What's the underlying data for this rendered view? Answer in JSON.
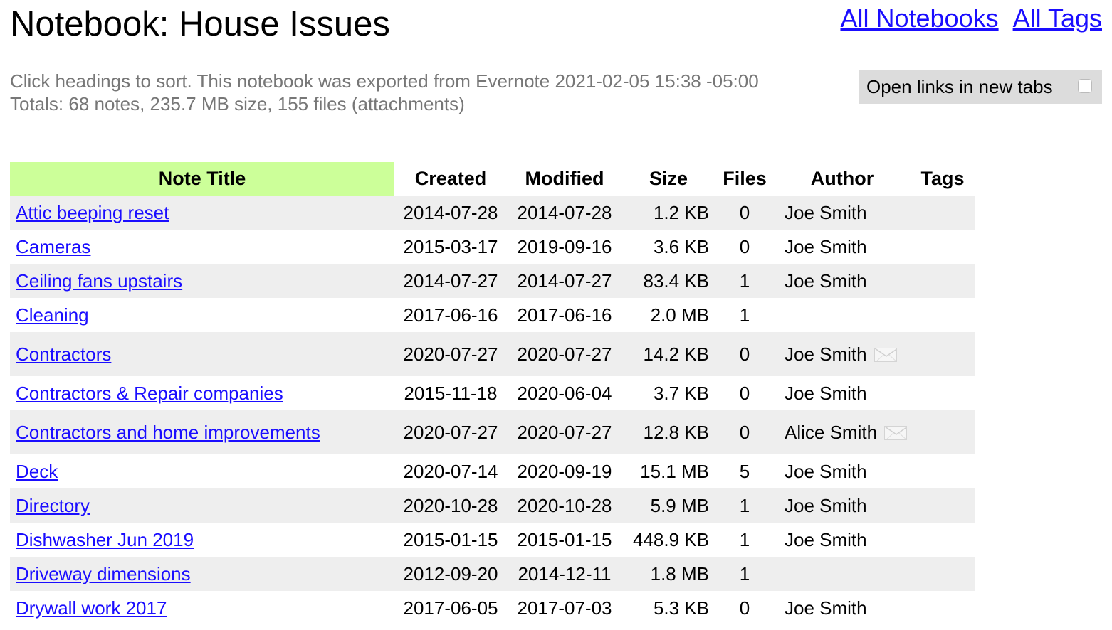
{
  "title": "Notebook: House Issues",
  "links": {
    "all_notebooks": "All Notebooks",
    "all_tags": "All Tags"
  },
  "info": {
    "line1": "Click headings to sort. This notebook was exported from Evernote 2021-02-05 15:38 -05:00",
    "line2": "Totals: 68 notes, 235.7 MB size, 155 files (attachments)"
  },
  "open_links_label": "Open links in new tabs",
  "open_links_checked": false,
  "colors": {
    "sorted_header": "#ccff99",
    "link": "#1a0dff",
    "row_shade": "#eeeeee",
    "info_text": "#777777",
    "toggle_bg": "#dcdcdc"
  },
  "table": {
    "headers": {
      "title": "Note Title",
      "created": "Created",
      "modified": "Modified",
      "size": "Size",
      "files": "Files",
      "author": "Author",
      "tags": "Tags"
    },
    "rows": [
      {
        "title": "Attic beeping reset",
        "created": "2014-07-28",
        "modified": "2014-07-28",
        "size": "1.2 KB",
        "files": "0",
        "author": "Joe Smith",
        "tags": ""
      },
      {
        "title": "Cameras",
        "created": "2015-03-17",
        "modified": "2019-09-16",
        "size": "3.6 KB",
        "files": "0",
        "author": "Joe Smith",
        "tags": ""
      },
      {
        "title": "Ceiling fans upstairs",
        "created": "2014-07-27",
        "modified": "2014-07-27",
        "size": "83.4 KB",
        "files": "1",
        "author": "Joe Smith",
        "tags": ""
      },
      {
        "title": "Cleaning",
        "created": "2017-06-16",
        "modified": "2017-06-16",
        "size": "2.0 MB",
        "files": "1",
        "author": "",
        "tags": ""
      },
      {
        "title": "Contractors",
        "created": "2020-07-27",
        "modified": "2020-07-27",
        "size": "14.2 KB",
        "files": "0",
        "author": "Joe Smith",
        "tags": "",
        "email_icon": "envelope-icon"
      },
      {
        "title": "Contractors & Repair companies",
        "created": "2015-11-18",
        "modified": "2020-06-04",
        "size": "3.7 KB",
        "files": "0",
        "author": "Joe Smith",
        "tags": ""
      },
      {
        "title": "Contractors and home improvements",
        "created": "2020-07-27",
        "modified": "2020-07-27",
        "size": "12.8 KB",
        "files": "0",
        "author": "Alice Smith",
        "tags": "",
        "email_icon": "envelope-icon"
      },
      {
        "title": "Deck",
        "created": "2020-07-14",
        "modified": "2020-09-19",
        "size": "15.1 MB",
        "files": "5",
        "author": "Joe Smith",
        "tags": ""
      },
      {
        "title": "Directory",
        "created": "2020-10-28",
        "modified": "2020-10-28",
        "size": "5.9 MB",
        "files": "1",
        "author": "Joe Smith",
        "tags": ""
      },
      {
        "title": "Dishwasher Jun 2019",
        "created": "2015-01-15",
        "modified": "2015-01-15",
        "size": "448.9 KB",
        "files": "1",
        "author": "Joe Smith",
        "tags": ""
      },
      {
        "title": "Driveway dimensions",
        "created": "2012-09-20",
        "modified": "2014-12-11",
        "size": "1.8 MB",
        "files": "1",
        "author": "",
        "tags": ""
      },
      {
        "title": "Drywall work 2017",
        "created": "2017-06-05",
        "modified": "2017-07-03",
        "size": "5.3 KB",
        "files": "0",
        "author": "Joe Smith",
        "tags": ""
      }
    ]
  }
}
